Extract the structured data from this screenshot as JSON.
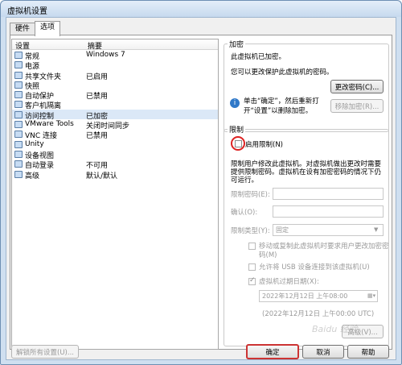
{
  "window": {
    "title": "虚拟机设置"
  },
  "tabs": [
    {
      "label": "硬件",
      "active": false
    },
    {
      "label": "选项",
      "active": true
    }
  ],
  "list": {
    "header_setting": "设置",
    "header_summary": "摘要",
    "items": [
      {
        "name": "常规",
        "summary": "Windows 7",
        "icon": "general-icon"
      },
      {
        "name": "电源",
        "summary": "",
        "icon": "power-icon"
      },
      {
        "name": "共享文件夹",
        "summary": "已启用",
        "icon": "shared-folder-icon"
      },
      {
        "name": "快照",
        "summary": "",
        "icon": "snapshot-icon"
      },
      {
        "name": "自动保护",
        "summary": "已禁用",
        "icon": "autoprotect-icon"
      },
      {
        "name": "客户机隔离",
        "summary": "",
        "icon": "isolation-icon"
      },
      {
        "name": "访问控制",
        "summary": "已加密",
        "icon": "lock-icon",
        "selected": true
      },
      {
        "name": "VMware Tools",
        "summary": "关闭时间同步",
        "icon": "vmware-tools-icon"
      },
      {
        "name": "VNC 连接",
        "summary": "已禁用",
        "icon": "vnc-icon"
      },
      {
        "name": "Unity",
        "summary": "",
        "icon": "unity-icon"
      },
      {
        "name": "设备视图",
        "summary": "",
        "icon": "device-view-icon"
      },
      {
        "name": "自动登录",
        "summary": "不可用",
        "icon": "autologin-icon"
      },
      {
        "name": "高级",
        "summary": "默认/默认",
        "icon": "advanced-icon"
      }
    ]
  },
  "encryption": {
    "group_label": "加密",
    "status": "此虚拟机已加密。",
    "desc": "您可以更改保护此虚拟机的密码。",
    "change_password_button": "更改密码(C)...",
    "info_line1": "单击“确定”，然后重新打",
    "info_line2": "开“设置”以删除加密。",
    "remove_encryption_button": "移除加密(R)..."
  },
  "restrictions": {
    "group_label": "限制",
    "enable_checkbox": "启用限制(N)",
    "enable_checked": false,
    "desc_line1": "限制用户修改此虚拟机。对虚拟机做出更改时需要",
    "desc_line2": "提供限制密码。虚拟机在设有加密密码的情况下仍",
    "desc_line3": "可运行。",
    "password_label": "限制密码(E):",
    "confirm_label": "确认(O):",
    "type_label": "限制类型(Y):",
    "type_value": "固定",
    "require_password_line1": "移动或复制此虚拟机时要求用户更改加密密",
    "require_password_line2": "码(M)",
    "require_password_checked": false,
    "usb_checkbox": "允许将 USB 设备连接到该虚拟机(U)",
    "usb_checked": false,
    "expire_checkbox": "虚拟机过期日期(X):",
    "expire_checked": true,
    "expire_date": "2022年12月12日 上午08:00",
    "expire_utc": "(2022年12月12日 上午00:00 UTC)",
    "advanced_button": "高级(V)..."
  },
  "footer": {
    "unlock_button": "解锁所有设置(U)...",
    "ok_button": "确定",
    "cancel_button": "取消",
    "help_button": "帮助"
  },
  "watermark": "Baidu 经验"
}
